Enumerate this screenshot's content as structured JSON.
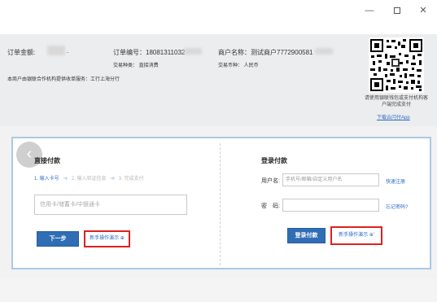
{
  "window": {
    "minimize": "—",
    "close": "✕"
  },
  "order": {
    "amount_label": "订单金额:",
    "amount_suffix": ".",
    "order_no": "订单编号：18081311032",
    "trade_type": "交易种类：  直接消费",
    "merchant": "商户名称：测试商户7772900581",
    "currency": "交易币种：  人民币",
    "service_note": "本商户由银联合作机构提供收单服务：工行上海分行"
  },
  "qr": {
    "hint": "请使用银联钱包或支付机构客户端完成支付",
    "download_link": "下载云闪付App"
  },
  "direct_pay": {
    "back_icon": "‹",
    "title": "直接付款",
    "step1": "1. 输入卡号",
    "step2": "2. 输入验证信息",
    "step3": "3. 完成支付",
    "arrow": "➜",
    "card_placeholder": "信用卡/储蓄卡/中银通卡",
    "next_button": "下一步",
    "demo_link": "新手操作演示 ⊕"
  },
  "login_pay": {
    "title": "登录付款",
    "username_label": "用户名:",
    "username_placeholder": "手机号/邮箱/自定义用户名",
    "register_link": "快速注册",
    "password_label": "密　码:",
    "forgot_link": "忘记密码?",
    "login_button": "登录付款",
    "demo_link": "新手操作演示 ⊕'"
  }
}
